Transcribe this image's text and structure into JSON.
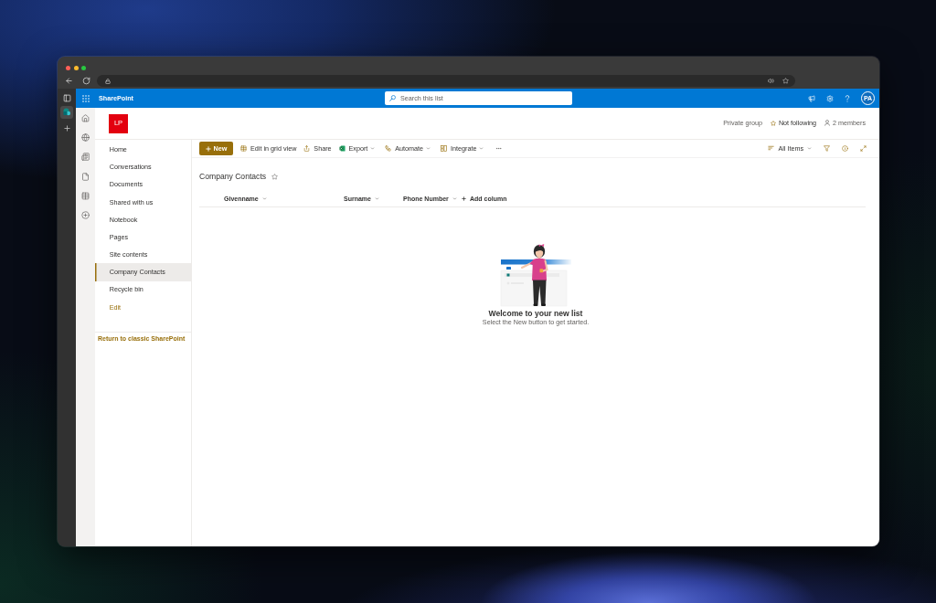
{
  "suite_bar": {
    "app_name": "SharePoint",
    "search": {
      "placeholder": "Search this list"
    },
    "avatar": "PA"
  },
  "site_header": {
    "logo": "LP",
    "privacy": "Private group",
    "follow": "Not following",
    "members": "2 members"
  },
  "site_nav": {
    "items": [
      {
        "label": "Home",
        "selected": false
      },
      {
        "label": "Conversations",
        "selected": false
      },
      {
        "label": "Documents",
        "selected": false
      },
      {
        "label": "Shared with us",
        "selected": false
      },
      {
        "label": "Notebook",
        "selected": false
      },
      {
        "label": "Pages",
        "selected": false
      },
      {
        "label": "Site contents",
        "selected": false
      },
      {
        "label": "Company Contacts",
        "selected": true
      },
      {
        "label": "Recycle bin",
        "selected": false
      }
    ],
    "edit_link": "Edit",
    "classic_link": "Return to classic SharePoint"
  },
  "command_bar": {
    "new_button": "New",
    "actions": [
      {
        "label": "Edit in grid view",
        "dropdown": false
      },
      {
        "label": "Share",
        "dropdown": false
      },
      {
        "label": "Export",
        "dropdown": true
      },
      {
        "label": "Automate",
        "dropdown": true
      },
      {
        "label": "Integrate",
        "dropdown": true
      }
    ],
    "view": "All Items"
  },
  "list": {
    "title": "Company Contacts",
    "columns": [
      "Givenname",
      "Surname",
      "Phone Number"
    ],
    "add_column": "Add column"
  },
  "empty_state": {
    "title": "Welcome to your new list",
    "message": "Select the New button to get started."
  }
}
